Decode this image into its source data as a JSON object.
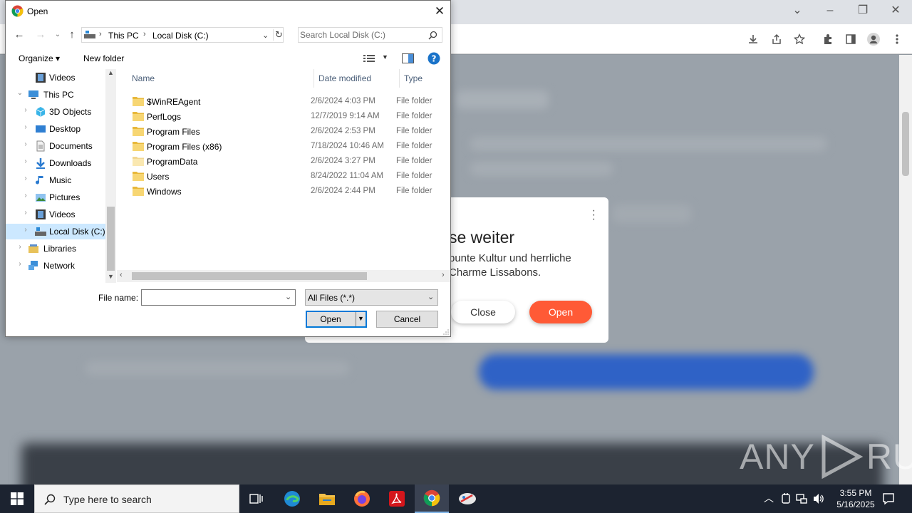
{
  "dialog": {
    "title": "Open",
    "breadcrumbs": [
      "This PC",
      "Local Disk (C:)"
    ],
    "search_placeholder": "Search Local Disk (C:)",
    "toolbar": {
      "organize": "Organize ▾",
      "new_folder": "New folder"
    },
    "nav_tree": [
      {
        "label": "Videos",
        "icon": "videos-icon",
        "level": 2,
        "expanded": null
      },
      {
        "label": "This PC",
        "icon": "pc-icon",
        "level": 1,
        "expanded": true
      },
      {
        "label": "3D Objects",
        "icon": "3d-objects-icon",
        "level": 2,
        "expanded": false
      },
      {
        "label": "Desktop",
        "icon": "desktop-icon",
        "level": 2,
        "expanded": false
      },
      {
        "label": "Documents",
        "icon": "documents-icon",
        "level": 2,
        "expanded": false
      },
      {
        "label": "Downloads",
        "icon": "downloads-icon",
        "level": 2,
        "expanded": false
      },
      {
        "label": "Music",
        "icon": "music-icon",
        "level": 2,
        "expanded": false
      },
      {
        "label": "Pictures",
        "icon": "pictures-icon",
        "level": 2,
        "expanded": false
      },
      {
        "label": "Videos",
        "icon": "videos-icon",
        "level": 2,
        "expanded": false
      },
      {
        "label": "Local Disk (C:)",
        "icon": "drive-icon",
        "level": 2,
        "expanded": false,
        "selected": true
      },
      {
        "label": "Libraries",
        "icon": "libraries-icon",
        "level": 1,
        "expanded": false
      },
      {
        "label": "Network",
        "icon": "network-icon",
        "level": 1,
        "expanded": false
      }
    ],
    "columns": {
      "name": "Name",
      "date": "Date modified",
      "type": "Type"
    },
    "files": [
      {
        "name": "$WinREAgent",
        "date": "2/6/2024 4:03 PM",
        "type": "File folder"
      },
      {
        "name": "PerfLogs",
        "date": "12/7/2019 9:14 AM",
        "type": "File folder"
      },
      {
        "name": "Program Files",
        "date": "2/6/2024 2:53 PM",
        "type": "File folder"
      },
      {
        "name": "Program Files (x86)",
        "date": "7/18/2024 10:46 AM",
        "type": "File folder"
      },
      {
        "name": "ProgramData",
        "date": "2/6/2024 3:27 PM",
        "type": "File folder",
        "hidden": true
      },
      {
        "name": "Users",
        "date": "8/24/2022 11:04 AM",
        "type": "File folder"
      },
      {
        "name": "Windows",
        "date": "2/6/2024 2:44 PM",
        "type": "File folder"
      }
    ],
    "file_name_label": "File name:",
    "file_name_value": "",
    "file_type": "All Files (*.*)",
    "open_label": "Open",
    "cancel_label": "Cancel"
  },
  "web_dialog": {
    "title": "se weiter",
    "text": "bunte Kultur und herrliche Charme Lissabons.",
    "close_label": "Close",
    "open_label": "Open",
    "accent": "#ff5a36"
  },
  "watermark": {
    "left": "ANY",
    "right": "RUN"
  },
  "taskbar": {
    "search_placeholder": "Type here to search",
    "apps": [
      "task-view-icon",
      "edge-icon",
      "file-explorer-icon",
      "firefox-icon",
      "acrobat-icon",
      "chrome-icon",
      "anyrun-icon"
    ],
    "time": "3:55 PM",
    "date": "5/16/2025"
  }
}
